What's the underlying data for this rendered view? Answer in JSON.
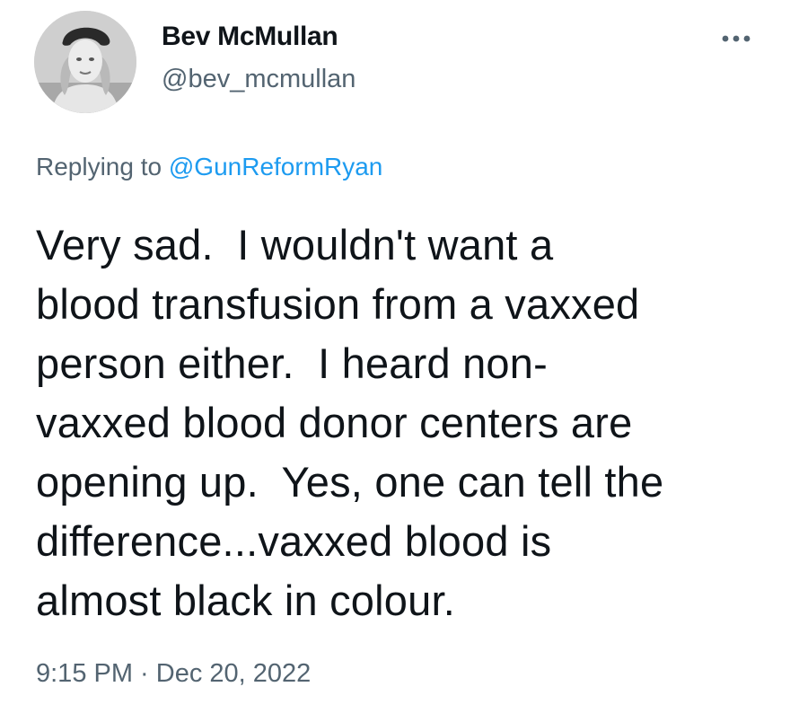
{
  "author": {
    "display_name": "Bev McMullan",
    "handle": "@bev_mcmullan",
    "avatar_icon": "profile-photo-grayscale"
  },
  "reply": {
    "prefix": "Replying to ",
    "mention": "@GunReformRyan"
  },
  "tweet": {
    "lines": [
      "Very sad.  I wouldn't want a",
      "blood transfusion from a vaxxed",
      "person either.  I heard non-",
      "vaxxed blood donor centers are",
      "opening up.  Yes, one can tell the",
      "difference...vaxxed blood is",
      "almost black in colour."
    ]
  },
  "timestamp": {
    "time": "9:15 PM",
    "separator": " · ",
    "date": "Dec 20, 2022"
  },
  "menu": {
    "icon": "more-horizontal-icon"
  },
  "colors": {
    "text": "#0f1419",
    "secondary": "#536471",
    "link": "#1d9bf0"
  }
}
